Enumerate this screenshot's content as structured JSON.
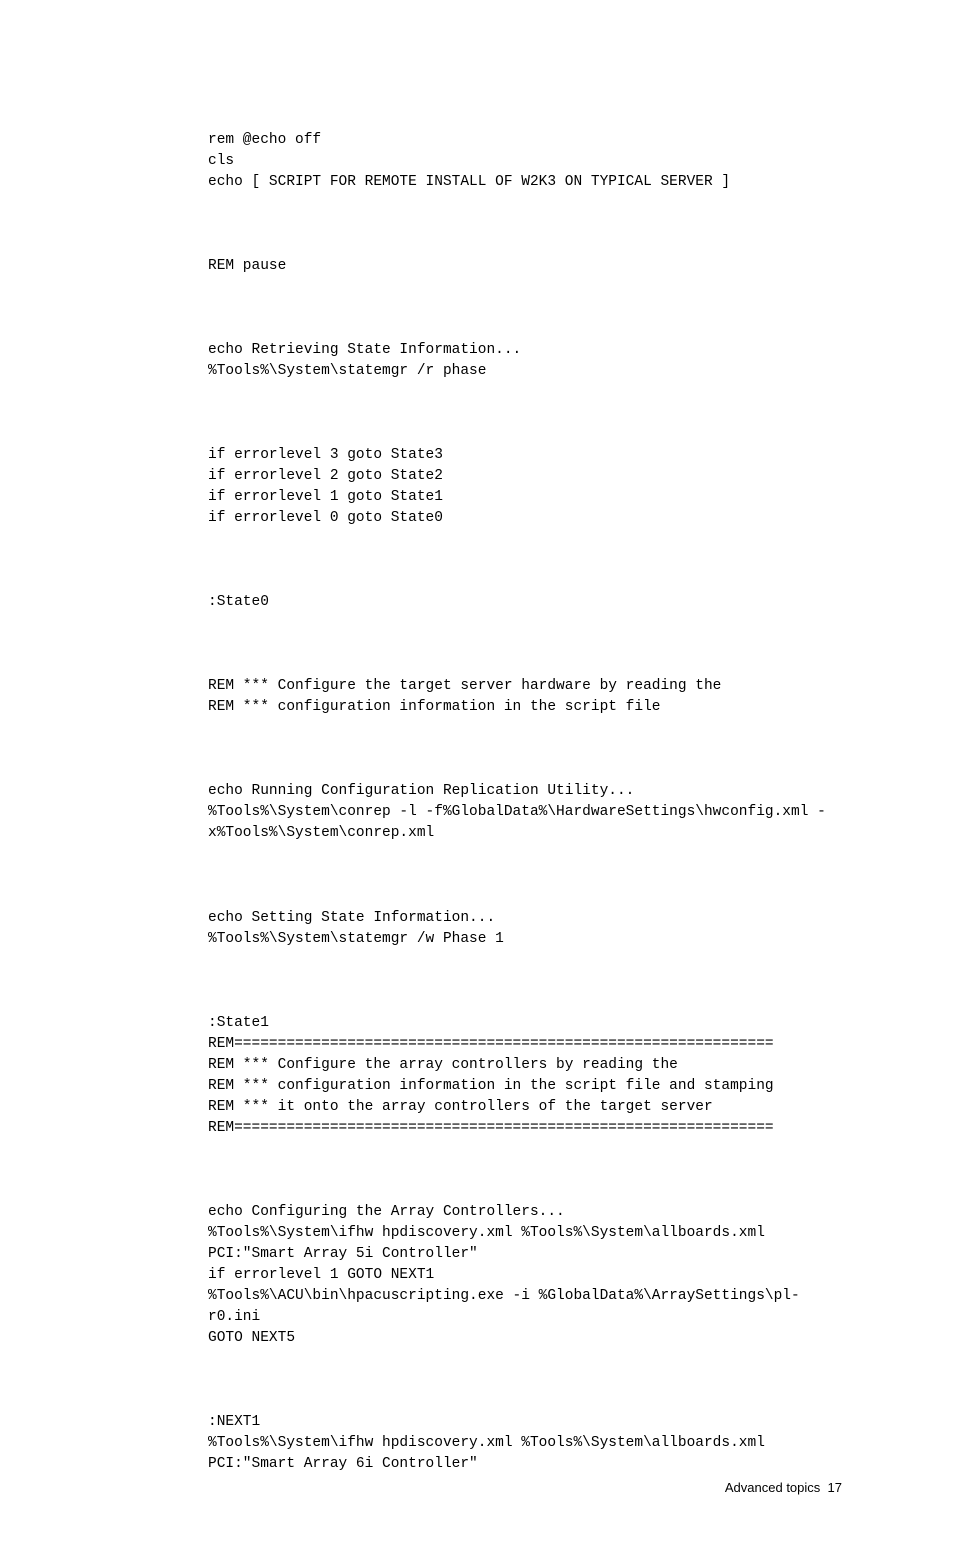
{
  "code": {
    "p1": "rem @echo off\ncls\necho [ SCRIPT FOR REMOTE INSTALL OF W2K3 ON TYPICAL SERVER ]",
    "p2": "REM pause",
    "p3": "echo Retrieving State Information...\n%Tools%\\System\\statemgr /r phase",
    "p4": "if errorlevel 3 goto State3\nif errorlevel 2 goto State2\nif errorlevel 1 goto State1\nif errorlevel 0 goto State0",
    "p5": ":State0",
    "p6": "REM *** Configure the target server hardware by reading the\nREM *** configuration information in the script file",
    "p7": "echo Running Configuration Replication Utility...\n%Tools%\\System\\conrep -l -f%GlobalData%\\HardwareSettings\\hwconfig.xml -x%Tools%\\System\\conrep.xml",
    "p8": "echo Setting State Information...\n%Tools%\\System\\statemgr /w Phase 1",
    "p9": ":State1\nREM==============================================================\nREM *** Configure the array controllers by reading the\nREM *** configuration information in the script file and stamping\nREM *** it onto the array controllers of the target server\nREM==============================================================",
    "p10": "echo Configuring the Array Controllers...\n%Tools%\\System\\ifhw hpdiscovery.xml %Tools%\\System\\allboards.xml PCI:\"Smart Array 5i Controller\"\nif errorlevel 1 GOTO NEXT1\n%Tools%\\ACU\\bin\\hpacuscripting.exe -i %GlobalData%\\ArraySettings\\pl-r0.ini\nGOTO NEXT5",
    "p11": ":NEXT1\n%Tools%\\System\\ifhw hpdiscovery.xml %Tools%\\System\\allboards.xml PCI:\"Smart Array 6i Controller\""
  },
  "footer": {
    "section": "Advanced topics",
    "page": "17"
  }
}
